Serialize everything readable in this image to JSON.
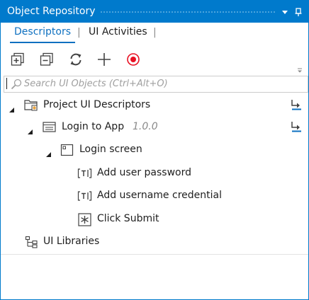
{
  "window": {
    "title": "Object Repository",
    "colors": {
      "accent": "#007acc",
      "tab_active": "#0e70c0",
      "record": "#e81123"
    }
  },
  "tabs": [
    {
      "label": "Descriptors",
      "active": true
    },
    {
      "label": "UI Activities",
      "active": false
    }
  ],
  "toolbar": {
    "buttons": [
      {
        "icon": "expand-all-icon"
      },
      {
        "icon": "collapse-all-icon"
      },
      {
        "icon": "refresh-icon"
      },
      {
        "icon": "add-icon"
      },
      {
        "icon": "record-icon"
      }
    ]
  },
  "search": {
    "placeholder": "Search UI Objects (Ctrl+Alt+O)",
    "value": ""
  },
  "tree": {
    "project": {
      "label": "Project UI Descriptors",
      "expanded": true
    },
    "app": {
      "label": "Login to App",
      "version": "1.0.0",
      "expanded": true
    },
    "screen": {
      "label": "Login screen",
      "expanded": true
    },
    "elements": [
      {
        "label": "Add user password",
        "icon": "text-field-icon"
      },
      {
        "label": "Add username credential",
        "icon": "text-field-icon"
      },
      {
        "label": "Click Submit",
        "icon": "click-element-icon"
      }
    ],
    "libraries": {
      "label": "UI Libraries"
    }
  }
}
